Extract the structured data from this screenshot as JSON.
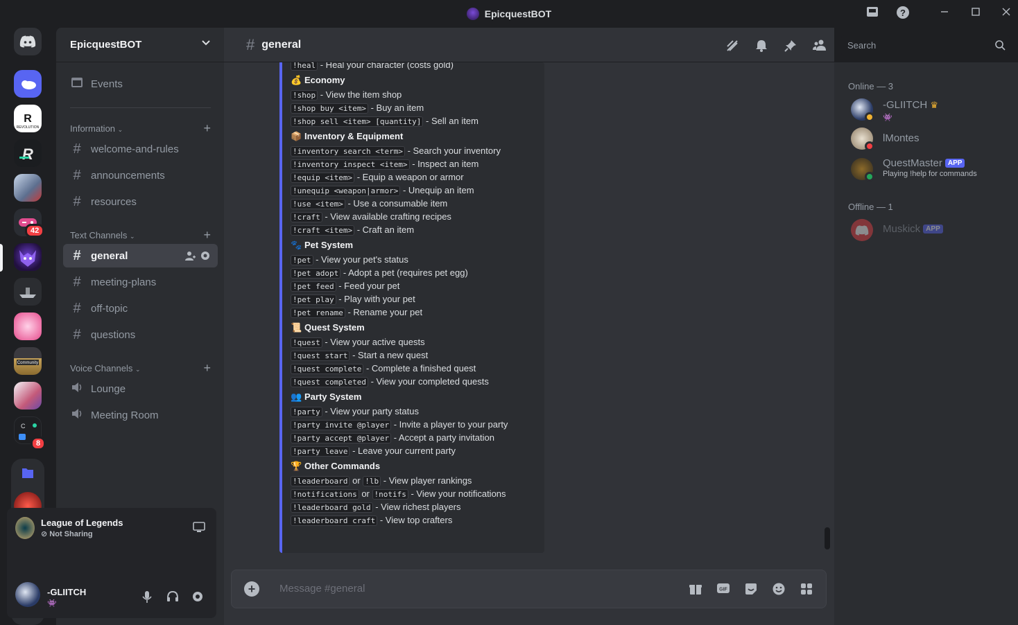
{
  "window": {
    "title": "EpicquestBOT"
  },
  "guild": {
    "name": "EpicquestBOT",
    "events_label": "Events"
  },
  "categories": {
    "information": "Information",
    "text": "Text Channels",
    "voice": "Voice Channels"
  },
  "info_channels": [
    "welcome-and-rules",
    "announcements",
    "resources"
  ],
  "text_channels": [
    "general",
    "meeting-plans",
    "off-topic",
    "questions"
  ],
  "voice_channels": [
    "Lounge",
    "Meeting Room"
  ],
  "server_badges": {
    "games": "42",
    "mixed": "8"
  },
  "activity": {
    "game": "League of Legends",
    "status": "Not Sharing"
  },
  "user": {
    "name": "-GLIITCH"
  },
  "header": {
    "channel": "general",
    "search_placeholder": "Search"
  },
  "composer": {
    "placeholder": "Message #general"
  },
  "embed": {
    "partial_top": {
      "cmd": "!heal",
      "desc": " - Heal your character (costs gold)"
    },
    "sections": [
      {
        "emoji": "💰",
        "title": "Economy",
        "lines": [
          {
            "parts": [
              {
                "c": "!shop"
              },
              {
                "t": " - View the item shop"
              }
            ]
          },
          {
            "parts": [
              {
                "c": "!shop buy <item>"
              },
              {
                "t": " - Buy an item"
              }
            ]
          },
          {
            "parts": [
              {
                "c": "!shop sell <item> [quantity]"
              },
              {
                "t": " - Sell an item"
              }
            ]
          }
        ]
      },
      {
        "emoji": "📦",
        "title": "Inventory & Equipment",
        "lines": [
          {
            "parts": [
              {
                "c": "!inventory search <term>"
              },
              {
                "t": " - Search your inventory"
              }
            ]
          },
          {
            "parts": [
              {
                "c": "!inventory inspect <item>"
              },
              {
                "t": " - Inspect an item"
              }
            ]
          },
          {
            "parts": [
              {
                "c": "!equip <item>"
              },
              {
                "t": " - Equip a weapon or armor"
              }
            ]
          },
          {
            "parts": [
              {
                "c": "!unequip <weapon|armor>"
              },
              {
                "t": " - Unequip an item"
              }
            ]
          },
          {
            "parts": [
              {
                "c": "!use <item>"
              },
              {
                "t": " - Use a consumable item"
              }
            ]
          },
          {
            "parts": [
              {
                "c": "!craft"
              },
              {
                "t": " - View available crafting recipes"
              }
            ]
          },
          {
            "parts": [
              {
                "c": "!craft <item>"
              },
              {
                "t": " - Craft an item"
              }
            ]
          }
        ]
      },
      {
        "emoji": "🐾",
        "title": "Pet System",
        "lines": [
          {
            "parts": [
              {
                "c": "!pet"
              },
              {
                "t": " - View your pet's status"
              }
            ]
          },
          {
            "parts": [
              {
                "c": "!pet adopt"
              },
              {
                "t": " - Adopt a pet (requires pet egg)"
              }
            ]
          },
          {
            "parts": [
              {
                "c": "!pet feed"
              },
              {
                "t": " - Feed your pet"
              }
            ]
          },
          {
            "parts": [
              {
                "c": "!pet play"
              },
              {
                "t": " - Play with your pet"
              }
            ]
          },
          {
            "parts": [
              {
                "c": "!pet rename"
              },
              {
                "t": " - Rename your pet"
              }
            ]
          }
        ]
      },
      {
        "emoji": "📜",
        "title": "Quest System",
        "lines": [
          {
            "parts": [
              {
                "c": "!quest"
              },
              {
                "t": " - View your active quests"
              }
            ]
          },
          {
            "parts": [
              {
                "c": "!quest start"
              },
              {
                "t": " - Start a new quest"
              }
            ]
          },
          {
            "parts": [
              {
                "c": "!quest complete"
              },
              {
                "t": " - Complete a finished quest"
              }
            ]
          },
          {
            "parts": [
              {
                "c": "!quest completed"
              },
              {
                "t": " - View your completed quests"
              }
            ]
          }
        ]
      },
      {
        "emoji": "👥",
        "title": "Party System",
        "lines": [
          {
            "parts": [
              {
                "c": "!party"
              },
              {
                "t": " - View your party status"
              }
            ]
          },
          {
            "parts": [
              {
                "c": "!party invite @player"
              },
              {
                "t": " - Invite a player to your party"
              }
            ]
          },
          {
            "parts": [
              {
                "c": "!party accept @player"
              },
              {
                "t": " - Accept a party invitation"
              }
            ]
          },
          {
            "parts": [
              {
                "c": "!party leave"
              },
              {
                "t": " - Leave your current party"
              }
            ]
          }
        ]
      },
      {
        "emoji": "🏆",
        "title": "Other Commands",
        "lines": [
          {
            "parts": [
              {
                "c": "!leaderboard"
              },
              {
                "t": " or "
              },
              {
                "c": "!lb"
              },
              {
                "t": " - View player rankings"
              }
            ]
          },
          {
            "parts": [
              {
                "c": "!notifications"
              },
              {
                "t": " or "
              },
              {
                "c": "!notifs"
              },
              {
                "t": " - View your notifications"
              }
            ]
          },
          {
            "parts": [
              {
                "c": "!leaderboard gold"
              },
              {
                "t": " - View richest players"
              }
            ]
          },
          {
            "parts": [
              {
                "c": "!leaderboard craft"
              },
              {
                "t": " - View top crafters"
              }
            ]
          }
        ]
      }
    ]
  },
  "members": {
    "online_label": "Online — 3",
    "offline_label": "Offline — 1",
    "online": [
      {
        "name": "-GLIITCH",
        "crown": "♛",
        "activity": "",
        "app": ""
      },
      {
        "name": "lMontes",
        "crown": "",
        "activity": "",
        "app": ""
      },
      {
        "name": "QuestMaster",
        "crown": "",
        "activity": "Playing !help for commands",
        "app": "APP"
      }
    ],
    "offline": [
      {
        "name": "Muskick",
        "app": "APP"
      }
    ]
  },
  "colors": {
    "accent": "#5865f2",
    "online": "#23a55a",
    "dnd": "#f23f43",
    "badge": "#f23f43"
  }
}
